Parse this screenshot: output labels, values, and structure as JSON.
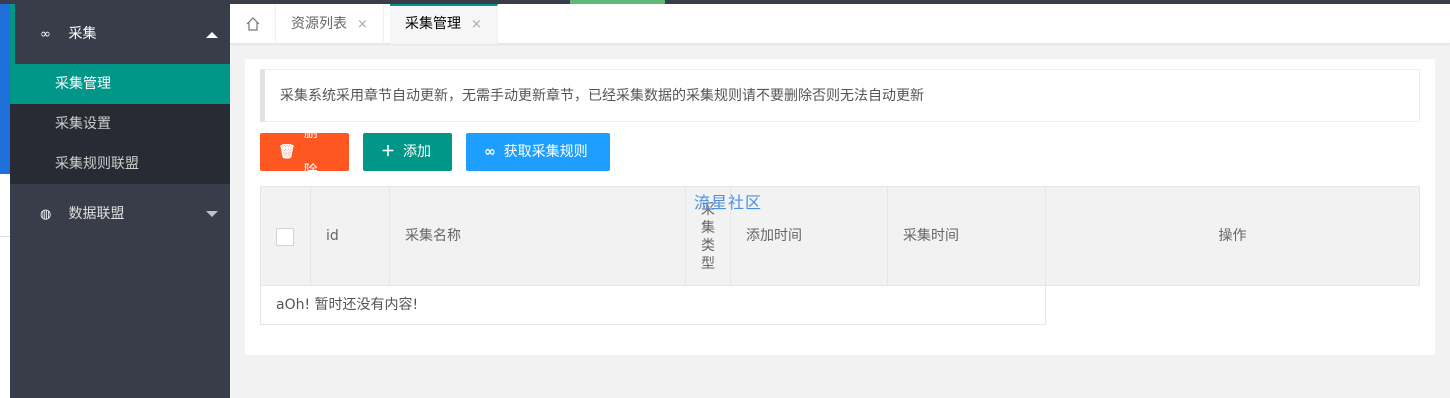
{
  "sidebar": {
    "group_collect": {
      "icon": "infinity-icon",
      "label": "采集"
    },
    "sub_items": [
      {
        "label": "采集管理",
        "active": true
      },
      {
        "label": "采集设置",
        "active": false
      },
      {
        "label": "采集规则联盟",
        "active": false
      }
    ],
    "group_data": {
      "icon": "globe-icon",
      "label": "数据联盟"
    }
  },
  "tabs": {
    "home_icon": "home-icon",
    "items": [
      {
        "label": "资源列表",
        "close": "×"
      },
      {
        "label": "采集管理",
        "close": "×",
        "active": true
      }
    ]
  },
  "main": {
    "notice": "采集系统采用章节自动更新，无需手动更新章节，已经采集数据的采集规则请不要删除否则无法自动更新",
    "buttons": {
      "delete": "删除",
      "add": "添加",
      "get_rules": "获取采集规则"
    },
    "table": {
      "headers": {
        "id": "id",
        "name": "采集名称",
        "type": "采集类型",
        "add_time": "添加时间",
        "collect_time": "采集时间",
        "actions": "操作"
      },
      "empty_text": "aOh! 暂时还没有内容!"
    },
    "watermark": "流星社区"
  },
  "colors": {
    "sidebar_bg": "#393d49",
    "active_green": "#009688",
    "danger": "#ff5722",
    "info_blue": "#1e9fff"
  }
}
